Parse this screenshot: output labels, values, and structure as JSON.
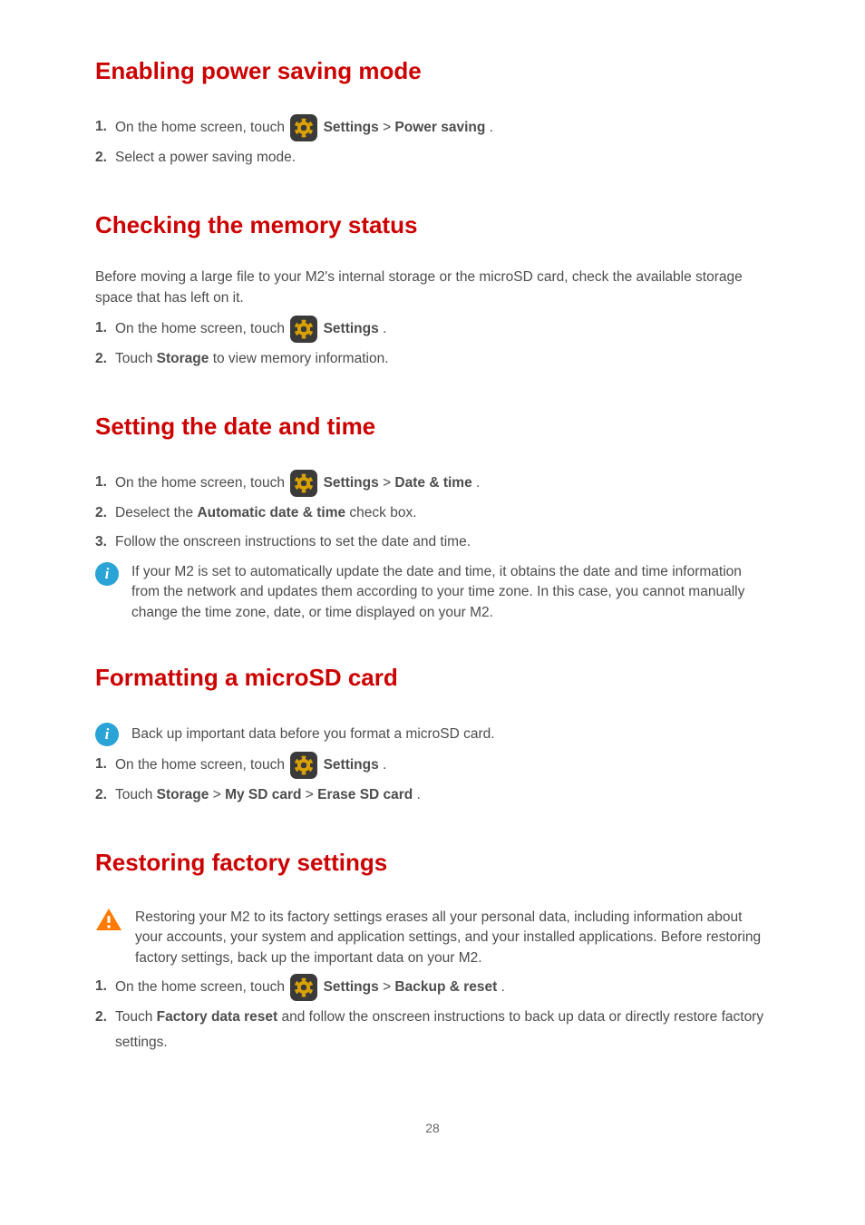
{
  "page_number": "28",
  "sections": [
    {
      "title": "Enabling power saving mode",
      "steps": [
        {
          "num": "1.",
          "pre": "On the home screen, touch ",
          "has_icon": true,
          "after": "Settings",
          "sep": " > ",
          "after2": "Power saving",
          "suffix": "."
        },
        {
          "num": "2.",
          "plain": "Select a power saving mode."
        }
      ]
    },
    {
      "title": "Checking the memory status",
      "intro": "Before moving a large file to your M2's internal storage or the microSD card, check the available storage space that has left on it.",
      "steps": [
        {
          "num": "1.",
          "pre": "On the home screen, touch ",
          "has_icon": true,
          "after": "Settings",
          "suffix": "."
        },
        {
          "num": "2.",
          "pre2": "Touch ",
          "bold": "Storage",
          "suffix": " to view memory information."
        }
      ]
    },
    {
      "title": "Setting the date and time",
      "steps": [
        {
          "num": "1.",
          "pre": "On the home screen, touch ",
          "has_icon": true,
          "after": "Settings",
          "sep": " > ",
          "after2": "Date & time",
          "suffix": "."
        },
        {
          "num": "2.",
          "pre2": "Deselect the ",
          "bold": "Automatic date & time",
          "suffix": " check box."
        },
        {
          "num": "3.",
          "plain": "Follow the onscreen instructions to set the date and time."
        }
      ],
      "note": {
        "type": "info",
        "text": "If your M2 is set to automatically update the date and time, it obtains the date and time information from the network and updates them according to your time zone. In this case, you cannot manually change the time zone, date, or time displayed on your M2."
      }
    },
    {
      "title": "Formatting a microSD card",
      "pre_note": {
        "type": "info",
        "text": "Back up important data before you format a microSD card."
      },
      "steps": [
        {
          "num": "1.",
          "pre": "On the home screen, touch ",
          "has_icon": true,
          "after": "Settings",
          "suffix": "."
        },
        {
          "num": "2.",
          "pre2": "Touch ",
          "bold": "Storage",
          "sep": " > ",
          "bold2": "My SD card",
          "sep2": " > ",
          "bold3": "Erase SD card",
          "suffix": "."
        }
      ]
    },
    {
      "title": "Restoring factory settings",
      "pre_note": {
        "type": "warn",
        "text": "Restoring your M2 to its factory settings erases all your personal data, including information about your accounts, your system and application settings, and your installed applications. Before restoring factory settings, back up the important data on your M2."
      },
      "steps": [
        {
          "num": "1.",
          "pre": "On the home screen, touch ",
          "has_icon": true,
          "after": "Settings",
          "sep": " > ",
          "after2": "Backup & reset",
          "suffix": "."
        },
        {
          "num": "2.",
          "pre2": "Touch ",
          "bold": "Factory data reset",
          "suffix": " and follow the onscreen instructions to back up data or directly restore factory settings."
        }
      ]
    }
  ],
  "info_glyph": "i"
}
